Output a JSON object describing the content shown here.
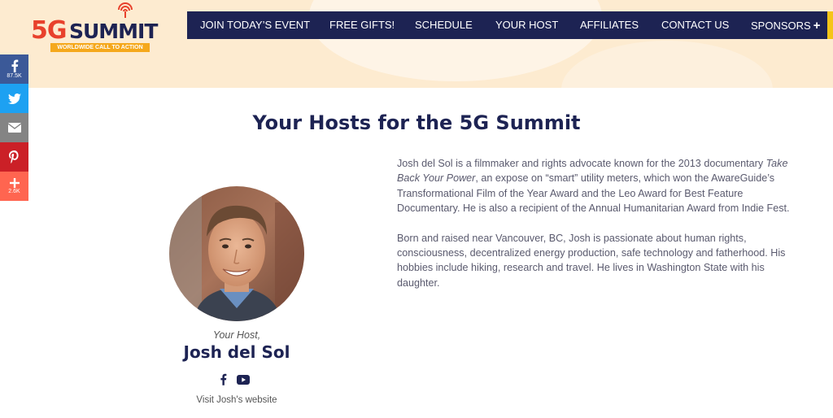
{
  "logo": {
    "part1": "5G",
    "part2": "SUMMIT",
    "tagline": "WORLDWIDE CALL TO ACTION"
  },
  "nav": {
    "items": [
      {
        "label": "JOIN TODAY’S EVENT"
      },
      {
        "label": "FREE GIFTS!"
      },
      {
        "label": "SCHEDULE"
      },
      {
        "label": "YOUR HOST"
      },
      {
        "label": "AFFILIATES"
      },
      {
        "label": "CONTACT US"
      },
      {
        "label": "SPONSORS"
      }
    ],
    "sponsors_plus": "+"
  },
  "share": {
    "facebook_count": "87.5K",
    "more_count": "2.6K",
    "icons": [
      "facebook-icon",
      "twitter-icon",
      "email-icon",
      "pinterest-icon",
      "plus-icon"
    ]
  },
  "page_title": "Your Hosts for the 5G Summit",
  "host": {
    "caption": "Your Host,",
    "name": "Josh del Sol",
    "website_link": "Visit Josh's website",
    "social_icons": [
      "facebook-icon",
      "youtube-icon"
    ]
  },
  "bio": {
    "p1_before": "Josh del Sol is a filmmaker and rights advocate known for the 2013 documentary ",
    "p1_title": "Take Back Your Power",
    "p1_after": ", an expose on “smart” utility meters, which won the AwareGuide’s Transformational Film of the Year Award and the Leo Award for Best Feature Documentary. He is also a recipient of the Annual Humanitarian Award from Indie Fest.",
    "p2": "Born and raised near Vancouver, BC, Josh is passionate about human rights, consciousness, decentralized energy production, safe technology and fatherhood. His hobbies include hiking, research and travel. He lives in Washington State with his daughter."
  },
  "colors": {
    "navy": "#1d2353",
    "accent_red": "#e8412c",
    "accent_orange": "#f5a81c",
    "header_bg": "#fdebd0"
  }
}
